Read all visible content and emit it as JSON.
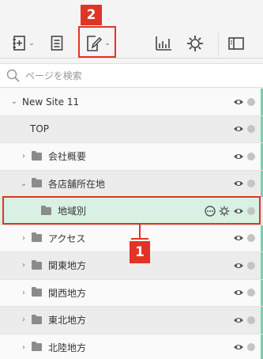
{
  "callouts": {
    "one": "1",
    "two": "2"
  },
  "toolbar": {
    "buttons": [
      {
        "name": "add-page",
        "icon": "add-page-icon",
        "has_caret": true
      },
      {
        "name": "page",
        "icon": "page-icon",
        "has_caret": false
      },
      {
        "name": "edit-page",
        "icon": "edit-page-icon",
        "has_caret": true
      },
      {
        "name": "analytics",
        "icon": "chart-icon",
        "has_caret": false
      },
      {
        "name": "settings",
        "icon": "gear-icon",
        "has_caret": false
      },
      {
        "name": "panel",
        "icon": "panel-icon",
        "has_caret": false
      }
    ]
  },
  "search": {
    "placeholder": "ページを検索",
    "value": ""
  },
  "tree": {
    "rows": [
      {
        "label": "New Site 11",
        "chevron": "expanded",
        "folder": false
      },
      {
        "label": "TOP",
        "chevron": "none",
        "folder": false
      },
      {
        "label": "会社概要",
        "chevron": "collapsed",
        "folder": true
      },
      {
        "label": "各店舗所在地",
        "chevron": "expanded",
        "folder": true
      },
      {
        "label": "地域別",
        "chevron": "none",
        "folder": true,
        "selected": true
      },
      {
        "label": "アクセス",
        "chevron": "collapsed",
        "folder": true
      },
      {
        "label": "関東地方",
        "chevron": "collapsed",
        "folder": true
      },
      {
        "label": "関西地方",
        "chevron": "collapsed",
        "folder": true
      },
      {
        "label": "東北地方",
        "chevron": "collapsed",
        "folder": true
      },
      {
        "label": "北陸地方",
        "chevron": "collapsed",
        "folder": true
      }
    ]
  },
  "colors": {
    "callout": "#e03524",
    "selected_row": "#d8f1e4",
    "accent_edge": "#79cfae"
  }
}
